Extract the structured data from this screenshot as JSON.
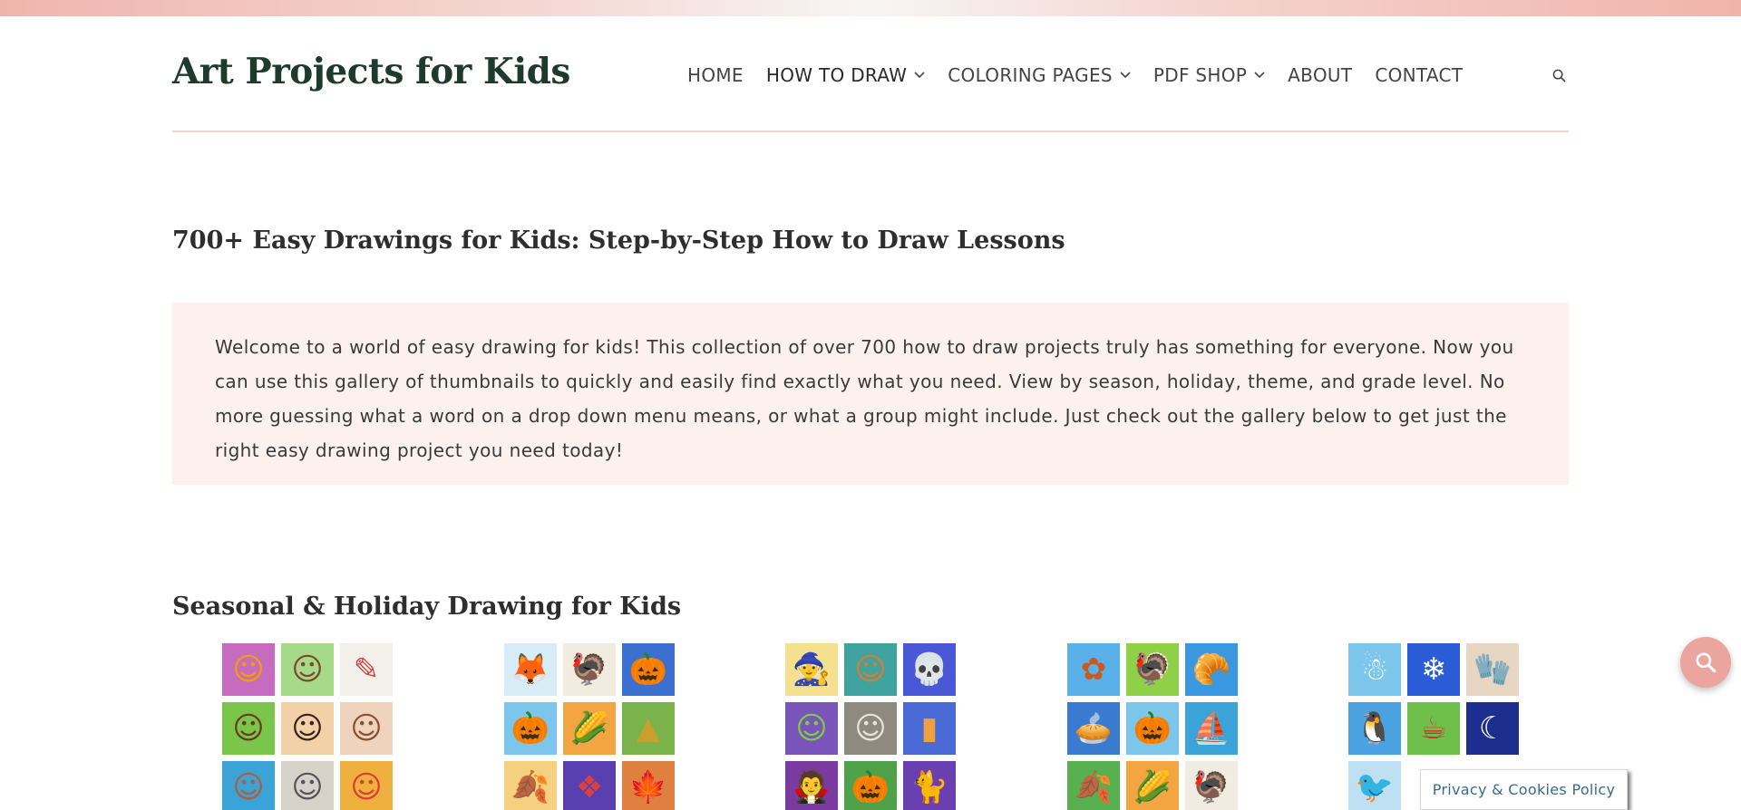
{
  "site": {
    "logo": "Art Projects for Kids"
  },
  "nav": {
    "items": [
      {
        "label": "HOME",
        "dropdown": false
      },
      {
        "label": "HOW TO DRAW",
        "dropdown": true
      },
      {
        "label": "COLORING PAGES",
        "dropdown": true
      },
      {
        "label": "PDF SHOP",
        "dropdown": true
      },
      {
        "label": "ABOUT",
        "dropdown": false
      },
      {
        "label": "CONTACT",
        "dropdown": false
      }
    ],
    "search_icon": "search-icon"
  },
  "main": {
    "title": "700+ Easy Drawings for Kids: Step-by-Step How to Draw Lessons",
    "intro": "Welcome to a world of easy drawing for kids! This collection of over 700 how to draw projects truly has something for everyone. Now you can use this gallery of thumbnails to quickly and easily find exactly what you need. View by season, holiday, theme, and grade level. No more guessing what a word on a drop down menu means, or what a group might include. Just check out the gallery below to get just the right easy drawing project you need today!",
    "section_title": "Seasonal & Holiday Drawing for Kids"
  },
  "gallery": [
    {
      "name": "people-portraits",
      "tiles": [
        {
          "bg": "#c66bc0",
          "fg": "#f0a000",
          "glyph": "☺"
        },
        {
          "bg": "#a7d98a",
          "fg": "#7a4b2a",
          "glyph": "☺"
        },
        {
          "bg": "#f3f0ea",
          "fg": "#d04040",
          "glyph": "✎"
        },
        {
          "bg": "#79c64a",
          "fg": "#6a3a1f",
          "glyph": "☺"
        },
        {
          "bg": "#f2d0a8",
          "fg": "#3a2418",
          "glyph": "☺"
        },
        {
          "bg": "#efd3bd",
          "fg": "#8a5030",
          "glyph": "☺"
        },
        {
          "bg": "#3aa3d8",
          "fg": "#b55a3a",
          "glyph": "☺"
        },
        {
          "bg": "#d7d3cb",
          "fg": "#555555",
          "glyph": "☺"
        },
        {
          "bg": "#efb040",
          "fg": "#d94030",
          "glyph": "☺"
        }
      ]
    },
    {
      "name": "fall",
      "tiles": [
        {
          "bg": "#d6ecf6",
          "fg": "#e0642a",
          "glyph": "🦊"
        },
        {
          "bg": "#f2ece0",
          "fg": "#a0522d",
          "glyph": "🦃"
        },
        {
          "bg": "#3b6fd0",
          "fg": "#f08a1c",
          "glyph": "🎃"
        },
        {
          "bg": "#7cc6ec",
          "fg": "#f2a020",
          "glyph": "🎃"
        },
        {
          "bg": "#f2a540",
          "fg": "#8a4a20",
          "glyph": "🌽"
        },
        {
          "bg": "#7ab34a",
          "fg": "#c8a030",
          "glyph": "▲"
        },
        {
          "bg": "#f5d080",
          "fg": "#c84a20",
          "glyph": "🍂"
        },
        {
          "bg": "#5a3fb0",
          "fg": "#d94040",
          "glyph": "❖"
        },
        {
          "bg": "#e08040",
          "fg": "#d23a1a",
          "glyph": "🍁"
        }
      ]
    },
    {
      "name": "halloween",
      "tiles": [
        {
          "bg": "#f5e090",
          "fg": "#6c3fc0",
          "glyph": "🧙"
        },
        {
          "bg": "#3fa3a0",
          "fg": "#e07a30",
          "glyph": "☺"
        },
        {
          "bg": "#4a58d8",
          "fg": "#ffffff",
          "glyph": "💀"
        },
        {
          "bg": "#7a54b8",
          "fg": "#7ad040",
          "glyph": "☺"
        },
        {
          "bg": "#8e8a80",
          "fg": "#e8e4dc",
          "glyph": "☺"
        },
        {
          "bg": "#4a6ad8",
          "fg": "#f0a040",
          "glyph": "▮"
        },
        {
          "bg": "#7a3aa0",
          "fg": "#f1f1f1",
          "glyph": "🧛"
        },
        {
          "bg": "#4fa24a",
          "fg": "#f2a020",
          "glyph": "🎃"
        },
        {
          "bg": "#6a3fb0",
          "fg": "#f08a1c",
          "glyph": "🐈"
        }
      ]
    },
    {
      "name": "thanksgiving",
      "tiles": [
        {
          "bg": "#5ab0e8",
          "fg": "#c85a20",
          "glyph": "✿"
        },
        {
          "bg": "#8ed048",
          "fg": "#a0522d",
          "glyph": "🦃"
        },
        {
          "bg": "#3a98e0",
          "fg": "#f08a1c",
          "glyph": "🥐"
        },
        {
          "bg": "#3a7ad0",
          "fg": "#e0a060",
          "glyph": "🥧"
        },
        {
          "bg": "#7cc6ec",
          "fg": "#f2a020",
          "glyph": "🎃"
        },
        {
          "bg": "#3aa3d8",
          "fg": "#ffffff",
          "glyph": "⛵"
        },
        {
          "bg": "#58b050",
          "fg": "#c85a20",
          "glyph": "🍂"
        },
        {
          "bg": "#f2a540",
          "fg": "#8a4a20",
          "glyph": "🌽"
        },
        {
          "bg": "#f0ece2",
          "fg": "#a0522d",
          "glyph": "🦃"
        }
      ]
    },
    {
      "name": "winter",
      "tiles": [
        {
          "bg": "#7cc6ec",
          "fg": "#ffffff",
          "glyph": "☃"
        },
        {
          "bg": "#2a5cd8",
          "fg": "#ffffff",
          "glyph": "❄"
        },
        {
          "bg": "#e7d6c2",
          "fg": "#d03a3a",
          "glyph": "🧤"
        },
        {
          "bg": "#4aa3e0",
          "fg": "#111111",
          "glyph": "🐧"
        },
        {
          "bg": "#6ec04a",
          "fg": "#d23030",
          "glyph": "☕"
        },
        {
          "bg": "#1c2f8e",
          "fg": "#ffffff",
          "glyph": "☾"
        },
        {
          "bg": "#bfe0f2",
          "fg": "#c83a3a",
          "glyph": "🐦"
        },
        {
          "bg": "#ffffff",
          "fg": "#ffffff",
          "glyph": ""
        },
        {
          "bg": "#ffffff",
          "fg": "#ffffff",
          "glyph": ""
        }
      ]
    }
  ],
  "fab_icon": "search-icon",
  "privacy": {
    "label": "Privacy & Cookies Policy"
  },
  "colors": {
    "accent": "#eba59f",
    "logo": "#1d3a2c",
    "intro_bg": "#fdf1ee",
    "link": "#356b8f"
  }
}
